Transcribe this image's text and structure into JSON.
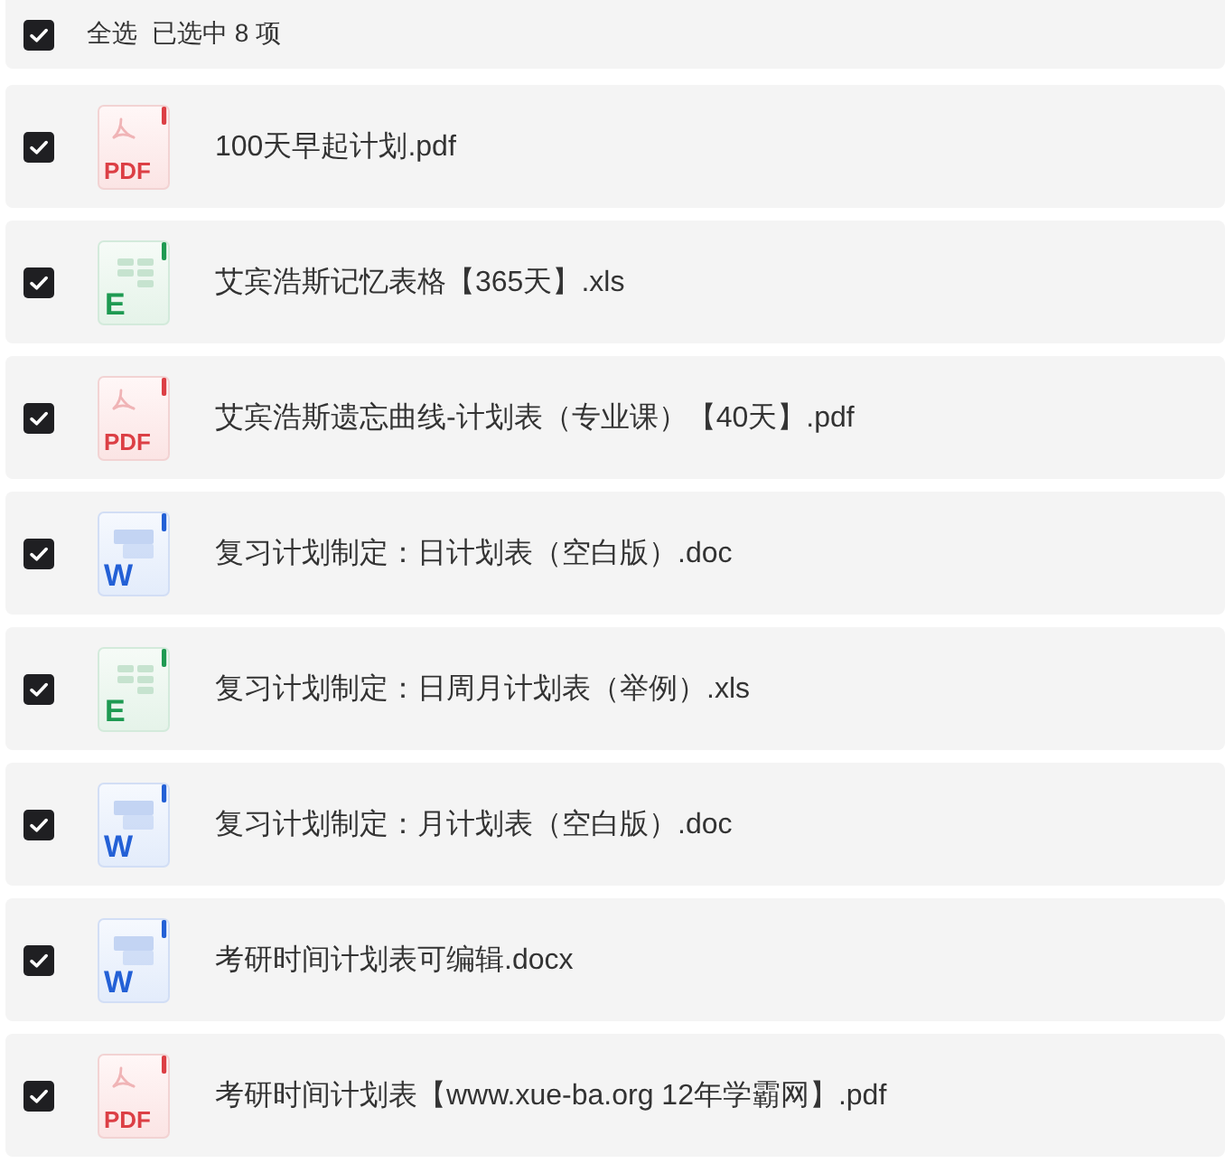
{
  "header": {
    "select_all": {
      "label": "全选",
      "checked": true
    },
    "selection_summary": "已选中 8 项"
  },
  "files": [
    {
      "name": "100天早起计划.pdf",
      "kind": "pdf",
      "icon_label": "PDF",
      "checked": true
    },
    {
      "name": "艾宾浩斯记忆表格【365天】.xls",
      "kind": "xls",
      "icon_label": "E",
      "checked": true
    },
    {
      "name": "艾宾浩斯遗忘曲线-计划表（专业课）【40天】.pdf",
      "kind": "pdf",
      "icon_label": "PDF",
      "checked": true
    },
    {
      "name": "复习计划制定：日计划表（空白版）.doc",
      "kind": "doc",
      "icon_label": "W",
      "checked": true
    },
    {
      "name": "复习计划制定：日周月计划表（举例）.xls",
      "kind": "xls",
      "icon_label": "E",
      "checked": true
    },
    {
      "name": "复习计划制定：月计划表（空白版）.doc",
      "kind": "doc",
      "icon_label": "W",
      "checked": true
    },
    {
      "name": "考研时间计划表可编辑.docx",
      "kind": "doc",
      "icon_label": "W",
      "checked": true
    },
    {
      "name": "考研时间计划表【www.xue-ba.org 12年学霸网】.pdf",
      "kind": "pdf",
      "icon_label": "PDF",
      "checked": true
    }
  ]
}
